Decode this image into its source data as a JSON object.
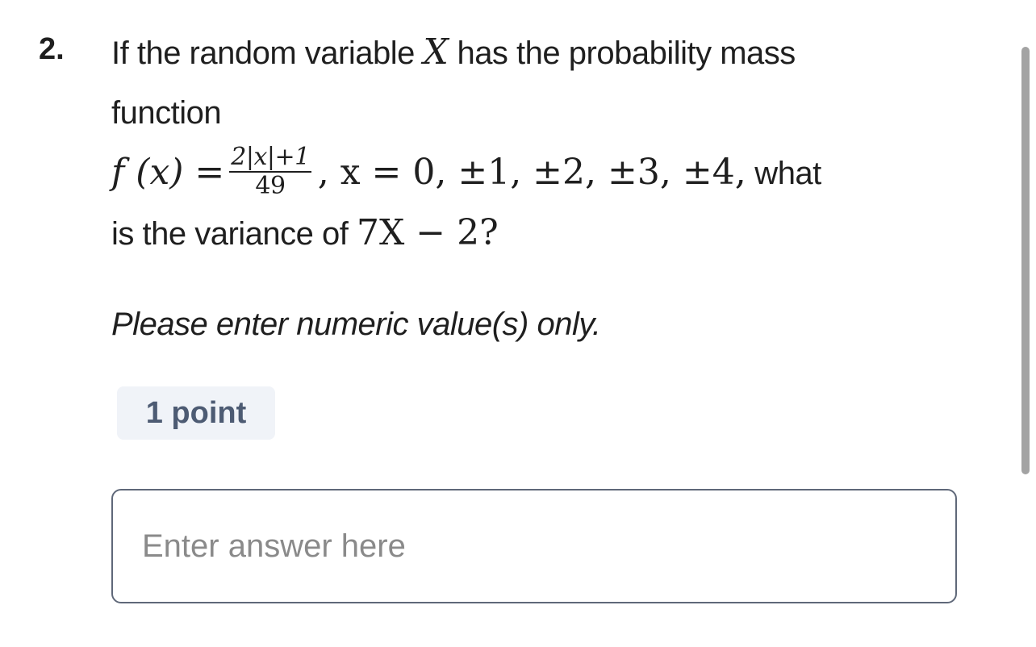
{
  "question": {
    "number": "2.",
    "line1_text": "If the random variable ",
    "var_X": "X",
    "line1_text2": " has the probability mass",
    "line2_text": "function",
    "f_of_x": "f (x) =",
    "frac_num": "2|x|+1",
    "frac_den": "49",
    "domain": ", x = 0, ±1, ±2, ±3, ±4,",
    "line3_tail": " what",
    "line4_text": "is the variance of ",
    "expr": "7X − 2?"
  },
  "instruction": "Please enter numeric value(s) only.",
  "points_badge": "1 point",
  "answer": {
    "placeholder": "Enter answer here",
    "value": ""
  },
  "colors": {
    "text": "#1f1f1f",
    "badge_bg": "#f0f3f8",
    "badge_text": "#4d5b73",
    "input_border": "#5f6879",
    "placeholder": "#8a8a8a",
    "scrollbar": "#a3a3a3"
  }
}
